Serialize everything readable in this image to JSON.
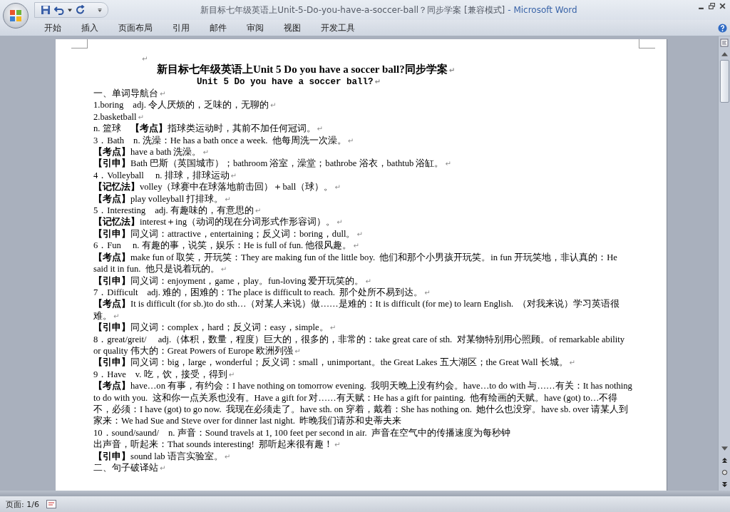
{
  "window": {
    "title": "新目标七年级英语上Unit-5-Do-you-have-a-soccer-ball？同步学案 [兼容模式]",
    "app": "- Microsoft Word"
  },
  "ribbon_tabs": [
    {
      "label": "开始"
    },
    {
      "label": "插入"
    },
    {
      "label": "页面布局"
    },
    {
      "label": "引用"
    },
    {
      "label": "邮件"
    },
    {
      "label": "审阅"
    },
    {
      "label": "视图"
    },
    {
      "label": "开发工具"
    }
  ],
  "document": {
    "paragraph_mark": "↵",
    "paragraphs": [
      {
        "kind": "blank",
        "mark": true
      },
      {
        "kind": "title",
        "text": "新目标七年级英语上Unit 5 Do you have a soccer ball?同步学案",
        "mark": true
      },
      {
        "kind": "subtitle",
        "text": "Unit 5 Do you have a soccer ball?",
        "mark": true
      },
      {
        "kind": "body",
        "text": "一、单词导航台",
        "mark": true
      },
      {
        "kind": "body",
        "text": "1.boring　adj. 令人厌烦的，乏味的，无聊的",
        "mark": true
      },
      {
        "kind": "body",
        "text": "2.basketball",
        "mark": true
      },
      {
        "kind": "body",
        "text": "n. 篮球　**【考点】**指球类运动时，其前不加任何冠词。",
        "mark": true
      },
      {
        "kind": "body",
        "text": "3．Bath　n. 洗澡：He has a bath once a week.  他每周洗一次澡。",
        "mark": true
      },
      {
        "kind": "body",
        "text": "**【考点】**have a bath 洗澡。",
        "mark": true
      },
      {
        "kind": "body",
        "text": "**【引申】**Bath 巴斯（英国城市）；bathroom 浴室，澡堂；bathrobe 浴衣，bathtub 浴缸。",
        "mark": true
      },
      {
        "kind": "body",
        "text": "4．Volleyball　 n. 排球，排球运动",
        "mark": true
      },
      {
        "kind": "body",
        "text": "**【记忆法】**volley（球赛中在球落地前击回）＋ball（球）。",
        "mark": true
      },
      {
        "kind": "body",
        "text": "**【考点】**play volleyball 打排球。",
        "mark": true
      },
      {
        "kind": "body",
        "text": "5．Interesting　adj. 有趣味的，有意思的",
        "mark": true
      },
      {
        "kind": "body",
        "text": "**【记忆法】**interest＋ing（动词的现在分词形式作形容词）。",
        "mark": true
      },
      {
        "kind": "body",
        "text": "**【引申】**同义词：attractive，entertaining；反义词：boring，dull。",
        "mark": true
      },
      {
        "kind": "body",
        "text": "6．Fun　 n. 有趣的事，说笑，娱乐：He is full of fun. 他很风趣。",
        "mark": true
      },
      {
        "kind": "body",
        "text": "**【考点】**make fun of 取笑，开玩笑：They are making fun of the little boy.  他们和那个小男孩开玩笑。in fun 开玩笑地，非认真的：He said it in fun.  他只是说着玩的。",
        "mark": true
      },
      {
        "kind": "body",
        "text": "**【引申】**同义词：enjoyment，game，play。fun-loving 爱开玩笑的。",
        "mark": true
      },
      {
        "kind": "body",
        "text": "7．Difficult　adj. 难的，困难的：The place is difficult to reach.  那个处所不易到达。",
        "mark": true
      },
      {
        "kind": "body",
        "text": "**【考点】**It is difficult (for sb.)to do sth…（对某人来说）做……是难的：It is difficult (for me) to learn English.  （对我来说）学习英语很难。",
        "mark": true
      },
      {
        "kind": "body",
        "text": "**【引申】**同义词：complex，hard；反义词：easy，simple。",
        "mark": true
      },
      {
        "kind": "body",
        "text": "8．great/greit/　 adj.（体积，数量，程度）巨大的，很多的，非常的：take great care of sth.  对某物特别用心照顾。of remarkable ability or quality 伟大的：Great Powers of Europe 欧洲列强",
        "mark": true
      },
      {
        "kind": "body",
        "text": "**【引申】**同义词：big，large，wonderful；反义词：small，unimportant。the Great Lakes 五大湖区；the Great Wall 长城。",
        "mark": true
      },
      {
        "kind": "body",
        "text": "9．Have　v. 吃，饮，接受，得到",
        "mark": true
      },
      {
        "kind": "body",
        "text": "**【考点】**have…on 有事，有约会：I have nothing on tomorrow evening.  我明天晚上没有约会。have…to do with 与……有关：It has nothing to do with you.  这和你一点关系也没有。Have a gift for 对……有天赋：He has a gift for painting.  他有绘画的天赋。have (got) to…不得不，必须：I have (got) to go now.  我现在必须走了。have sth. on 穿着，戴着：She has nothing on.  她什么也没穿。have sb. over 请某人到家来：We had Sue and Steve over for dinner last night.  昨晚我们请苏和史蒂夫来",
        "mark": false
      },
      {
        "kind": "body",
        "text": "10．sound/saund/　n. 声音：Sound travels at 1, 100 feet per second in air.  声音在空气中的传播速度为每秒钟",
        "mark": false
      },
      {
        "kind": "body",
        "text": "出声音，听起来：That sounds interesting!  那听起来很有趣！",
        "mark": true
      },
      {
        "kind": "body",
        "text": "**【引申】**sound lab 语言实验室。",
        "mark": true
      },
      {
        "kind": "body",
        "text": "二、句子破译站",
        "mark": true
      }
    ]
  },
  "status_bar": {
    "page": "页面: 1/6"
  }
}
